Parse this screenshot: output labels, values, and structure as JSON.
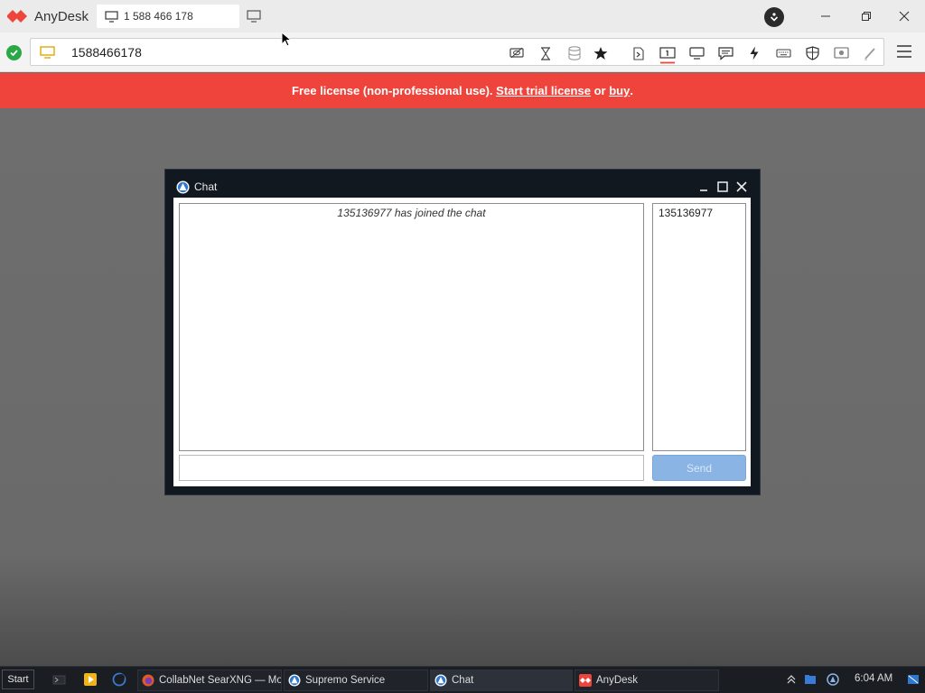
{
  "app": {
    "name": "AnyDesk",
    "tab_label": "1 588 466 178",
    "address": "1588466178",
    "brand_color": "#ef443b"
  },
  "license_bar": {
    "prefix": "Free license (non-professional use). ",
    "trial_link": "Start trial license",
    "middle": " or ",
    "buy_link": "buy",
    "suffix": "."
  },
  "toolbar_icons": [
    "privacy-icon",
    "hourglass-icon",
    "database-icon",
    "star-icon",
    "file-transfer-icon",
    "monitor-select-icon",
    "display-icon",
    "chat-icon",
    "actions-icon",
    "keyboard-icon",
    "permissions-icon",
    "record-icon",
    "whiteboard-icon",
    "menu-icon"
  ],
  "chat_window": {
    "title": "Chat",
    "messages": [
      "135136977 has joined the chat"
    ],
    "participants": [
      "135136977"
    ],
    "input_value": "",
    "send_label": "Send"
  },
  "taskbar": {
    "start_label": "Start",
    "tasks": [
      {
        "label": "CollabNet SearXNG — Mo..."
      },
      {
        "label": "Supremo Service"
      },
      {
        "label": "Chat"
      },
      {
        "label": "AnyDesk"
      }
    ],
    "clock": "6:04 AM"
  }
}
